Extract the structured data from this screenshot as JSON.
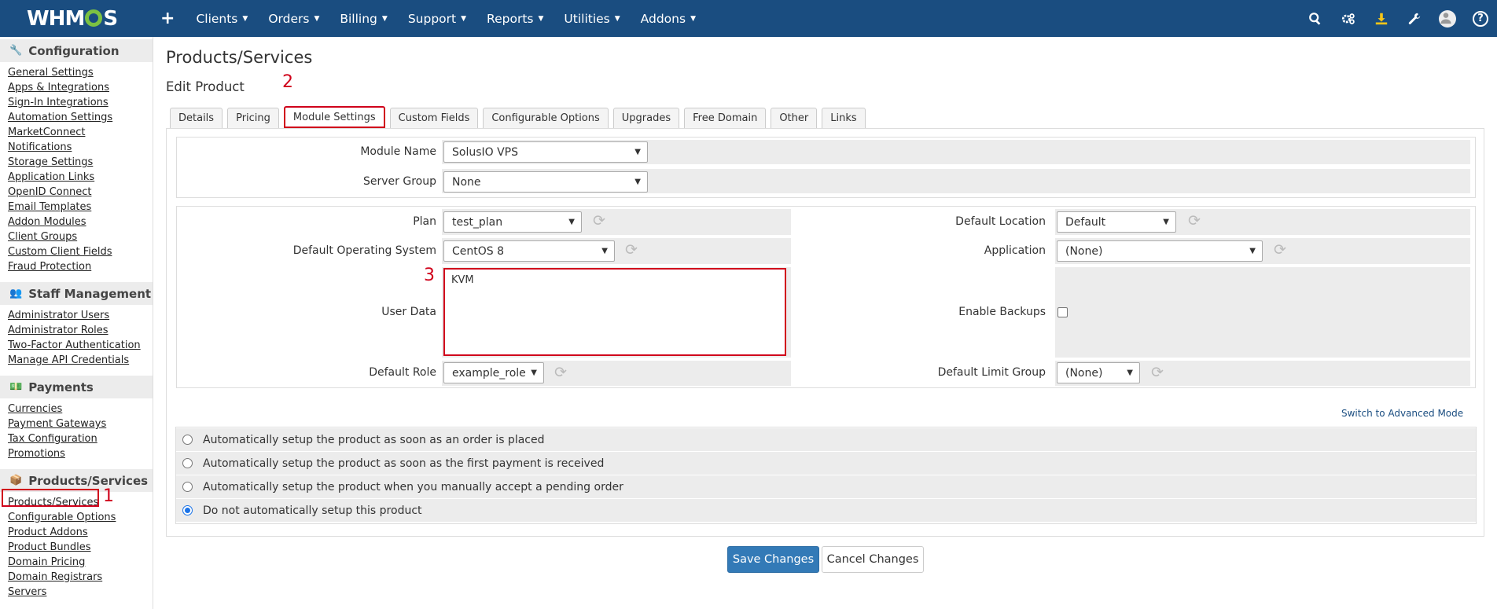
{
  "topnav": {
    "logo": "WHMCS",
    "logo_parts": [
      "WHM",
      "S"
    ],
    "plus": "+",
    "items": [
      "Clients",
      "Orders",
      "Billing",
      "Support",
      "Reports",
      "Utilities",
      "Addons"
    ],
    "icons": [
      "search-icon",
      "cogs-icon",
      "download-icon",
      "wrench-icon",
      "avatar-icon",
      "help-icon"
    ],
    "help_glyph": "?"
  },
  "sidebar": {
    "sections": [
      {
        "title": "Configuration",
        "icon": "wrench-icon",
        "links": [
          "General Settings",
          "Apps & Integrations",
          "Sign-In Integrations",
          "Automation Settings",
          "MarketConnect",
          "Notifications",
          "Storage Settings",
          "Application Links",
          "OpenID Connect",
          "Email Templates",
          "Addon Modules",
          "Client Groups",
          "Custom Client Fields",
          "Fraud Protection"
        ]
      },
      {
        "title": "Staff Management",
        "icon": "users-icon",
        "links": [
          "Administrator Users",
          "Administrator Roles",
          "Two-Factor Authentication",
          "Manage API Credentials"
        ]
      },
      {
        "title": "Payments",
        "icon": "money-icon",
        "links": [
          "Currencies",
          "Payment Gateways",
          "Tax Configuration",
          "Promotions"
        ]
      },
      {
        "title": "Products/Services",
        "icon": "cubes-icon",
        "links": [
          "Products/Services",
          "Configurable Options",
          "Product Addons",
          "Product Bundles",
          "Domain Pricing",
          "Domain Registrars",
          "Servers"
        ]
      }
    ]
  },
  "annotations": {
    "one": "1",
    "two": "2",
    "three": "3"
  },
  "main": {
    "page_title": "Products/Services",
    "sub_title": "Edit Product",
    "tabs": [
      "Details",
      "Pricing",
      "Module Settings",
      "Custom Fields",
      "Configurable Options",
      "Upgrades",
      "Free Domain",
      "Other",
      "Links"
    ],
    "active_tab": "Module Settings",
    "module": {
      "module_name_label": "Module Name",
      "module_name_value": "SolusIO VPS",
      "server_group_label": "Server Group",
      "server_group_value": "None"
    },
    "settings": {
      "plan_label": "Plan",
      "plan_value": "test_plan",
      "default_location_label": "Default Location",
      "default_location_value": "Default",
      "default_os_label": "Default Operating System",
      "default_os_value": "CentOS 8",
      "application_label": "Application",
      "application_value": "(None)",
      "user_data_label": "User Data",
      "user_data_value": "KVM",
      "enable_backups_label": "Enable Backups",
      "enable_backups_checked": false,
      "default_role_label": "Default Role",
      "default_role_value": "example_role",
      "default_limit_group_label": "Default Limit Group",
      "default_limit_group_value": "(None)"
    },
    "advanced_link": "Switch to Advanced Mode",
    "setup_options": [
      "Automatically setup the product as soon as an order is placed",
      "Automatically setup the product as soon as the first payment is received",
      "Automatically setup the product when you manually accept a pending order",
      "Do not automatically setup this product"
    ],
    "setup_selected_index": 3,
    "save_label": "Save Changes",
    "cancel_label": "Cancel Changes"
  },
  "colors": {
    "nav_bg": "#1a4d80",
    "highlight": "#d0021b",
    "primary_button": "#337ab7",
    "logo_gear": "#7cc242"
  }
}
